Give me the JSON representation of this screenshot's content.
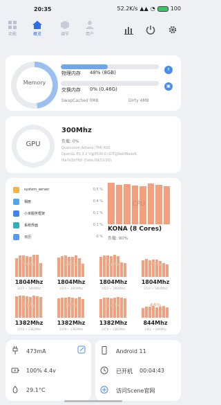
{
  "status": {
    "time": "20:35",
    "speed": "52.2K/s",
    "battery": "100"
  },
  "tabs": [
    {
      "label": "功能",
      "active": false
    },
    {
      "label": "概览",
      "active": true
    },
    {
      "label": "调节",
      "active": false
    },
    {
      "label": "用户",
      "active": false
    }
  ],
  "memory": {
    "ring_label": "Memory",
    "ram_label": "物理内存",
    "ram_value": "48% (8GB)",
    "ram_percent": 48,
    "swap_label": "交换内存",
    "swap_value": "0% (0.46G)",
    "swap_percent": 0,
    "swapcached": "SwapCached 0MB",
    "dirty": "Dirty 4MB"
  },
  "gpu": {
    "ring_label": "GPU",
    "freq": "300Mhz",
    "load": "负载: 0%",
    "line1": "Qualcomm Adreno (TM) 650",
    "line2": "OpenGL ES 3.2 V@0530.0 (GIT@9e0f8ade6,",
    "line3": "I6a7d1b7fd) (Date:09/22/20)"
  },
  "processes": [
    {
      "name": "system_server",
      "value": "0.5 %",
      "color": "#f1b64a"
    },
    {
      "name": "相册",
      "value": "0.4 %",
      "color": "#4aa8ef"
    },
    {
      "name": "小米服务框架",
      "value": "0.1 %",
      "color": "#3d86f0"
    },
    {
      "name": "系统界面",
      "value": "0.1 %",
      "color": "#2fb0c2"
    },
    {
      "name": "日历",
      "value": "0 %",
      "color": "#5a9af0"
    }
  ],
  "cpu": {
    "label": "CPU",
    "soc": "KONA (8 Cores)",
    "load": "负载: 90%"
  },
  "cores": [
    {
      "pct": "90%",
      "freq": "1804Mhz",
      "range": "1420 ~ 1804Mhz"
    },
    {
      "pct": "88%",
      "freq": "1804Mhz",
      "range": "1420 ~ 1804Mhz"
    },
    {
      "pct": "90%",
      "freq": "1804Mhz",
      "range": "1420 ~ 1804Mhz"
    },
    {
      "pct": "75%",
      "freq": "1804Mhz",
      "range": "1420 ~ 1804Mhz"
    },
    {
      "pct": "95%",
      "freq": "1382Mhz",
      "range": "1478 ~ 1382Mhz"
    },
    {
      "pct": "84%",
      "freq": "1382Mhz",
      "range": "1478 ~ 1382Mhz"
    },
    {
      "pct": "84%",
      "freq": "1382Mhz",
      "range": "1478 ~ 1382Mhz"
    },
    {
      "pct": "48%",
      "freq": "844Mhz",
      "range": "1462 ~ 844Mhz"
    }
  ],
  "battery": {
    "current": "473mA",
    "level": "100%  4.4v",
    "temp": "29.1°C"
  },
  "system": {
    "android": "Android 11",
    "uptime_label": "已开机",
    "uptime": "00:04:43",
    "visit": "访问Scene官网"
  }
}
